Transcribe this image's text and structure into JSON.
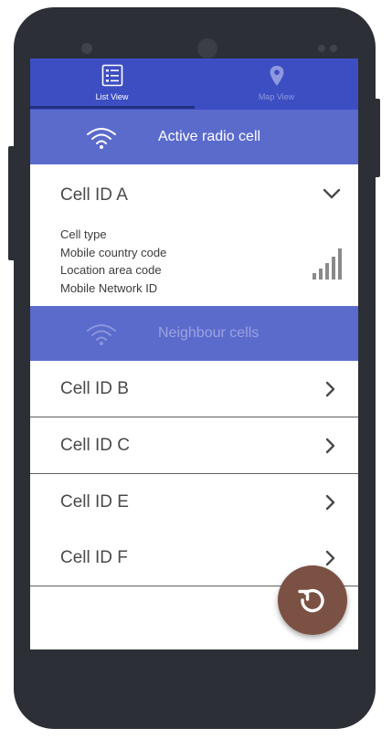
{
  "tabs": [
    {
      "label": "List View",
      "icon": "list-icon",
      "selected": true
    },
    {
      "label": "Map View",
      "icon": "map-pin-icon",
      "selected": false
    }
  ],
  "active_section": {
    "title": "Active radio cell",
    "icon": "wifi-icon"
  },
  "active_cell": {
    "title": "Cell ID A",
    "expanded": true,
    "details": [
      "Cell type",
      "Mobile country code",
      "Location area code",
      "Mobile Network ID"
    ],
    "signal_icon": "signal-strength-icon"
  },
  "neighbour_section": {
    "title": "Neighbour cells",
    "icon": "wifi-icon"
  },
  "neighbour_cells": [
    {
      "label": "Cell ID B"
    },
    {
      "label": "Cell ID C"
    },
    {
      "label": "Cell ID E"
    },
    {
      "label": "Cell ID F"
    }
  ],
  "fab": {
    "icon": "refresh-icon"
  },
  "colors": {
    "tab_bar": "#3c4ec2",
    "section_header": "#5b6bcc",
    "fab": "#7b5144",
    "phone_body": "#2c2f36"
  }
}
